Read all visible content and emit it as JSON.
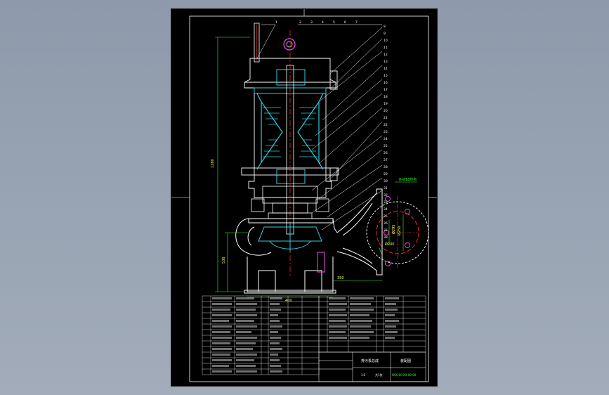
{
  "drawing": {
    "flange_note": "8-Ø18均布",
    "balloons": [
      "1",
      "2",
      "3",
      "4",
      "5",
      "6",
      "7",
      "8",
      "9",
      "10",
      "11",
      "12",
      "13",
      "14",
      "15",
      "16",
      "17",
      "18",
      "19",
      "20",
      "21",
      "22",
      "23",
      "24",
      "25",
      "26",
      "27",
      "28",
      "29",
      "30",
      "31",
      "32",
      "33",
      "34",
      "35",
      "36",
      "37",
      "38"
    ],
    "dims": {
      "overall_height": "1280",
      "lower_height": "530",
      "base_width": "400",
      "outlet_offset": "350",
      "flange_d1": "Ø295",
      "flange_d2": "Ø250",
      "outlet_dia": "Ø200"
    }
  },
  "title_block": {
    "drawing_name": "装配图",
    "company_name": "排污泵总成",
    "drawing_number": "WQ200-XX-00-00",
    "scale_label": "1:5",
    "sheet_label": "共1张"
  },
  "colors": {
    "sheet": "#000000",
    "outline": "#ffffff",
    "section": "#33ccdd",
    "dims": "#33ff33",
    "hidden": "#ff3333",
    "callout": "#ffffff",
    "highlight": "#ff44ff"
  }
}
